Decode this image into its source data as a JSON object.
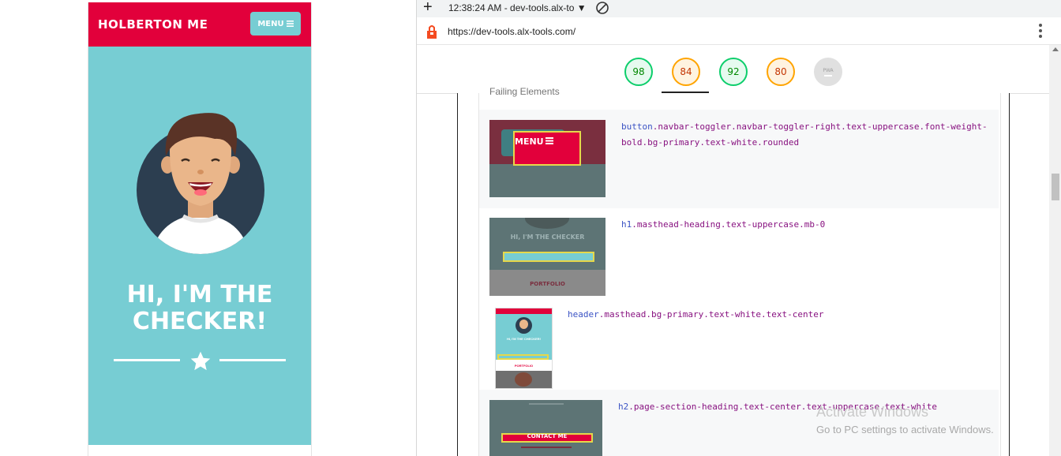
{
  "preview": {
    "brand": "HOLBERTON ME",
    "menu_label": "MENU",
    "menu_icon": "hamburger-icon",
    "hero_line1": "HI, I'M THE",
    "hero_line2": "CHECKER!",
    "colors": {
      "navbar": "#e2003b",
      "masthead": "#77cdd3",
      "avatar_bg": "#2c3e50"
    }
  },
  "devtools": {
    "time": "12:38:24 AM - dev-tools.alx-to",
    "url": "https://dev-tools.alx-tools.com/",
    "scores": [
      {
        "value": "98",
        "status": "pass"
      },
      {
        "value": "84",
        "status": "average"
      },
      {
        "value": "92",
        "status": "pass"
      },
      {
        "value": "80",
        "status": "average"
      },
      {
        "value": "PWA",
        "status": "na"
      }
    ],
    "section_label": "Failing Elements",
    "rows": [
      {
        "tag": "button",
        "classes": ".navbar-toggler.navbar-toggler-right.text-uppercase.font-weight-",
        "classes2": "bold.bg-primary.text-white.rounded",
        "thumb_text": "MENU"
      },
      {
        "tag": "h1",
        "classes": ".masthead-heading.text-uppercase.mb-0",
        "thumb_text": "HI, I'M THE CHECKER",
        "thumb_text2": "PORTFOLIO"
      },
      {
        "tag": "header",
        "classes": ".masthead.bg-primary.text-white.text-center",
        "thumb_text": "HI, I'M THE CHECKER!",
        "thumb_text2": "PORTFOLIO"
      },
      {
        "tag": "h2",
        "classes": ".page-section-heading.text-center.text-uppercase.text-white",
        "thumb_text": "CONTACT ME"
      }
    ]
  },
  "watermark": {
    "line1": "Activate Windows",
    "line2": "Go to PC settings to activate Windows."
  }
}
